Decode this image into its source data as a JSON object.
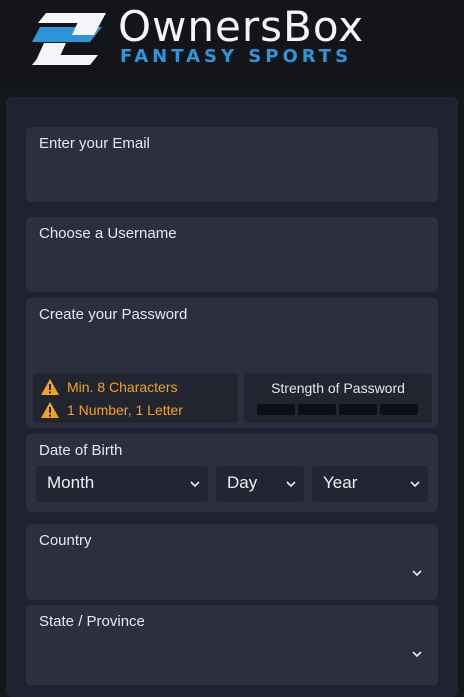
{
  "brand": {
    "name": "OwnersBox",
    "tagline": "FANTASY SPORTS"
  },
  "colors": {
    "accent": "#2f95da",
    "warning": "#f0a41f",
    "field_bg": "#2b2f40",
    "page_bg": "#15171f"
  },
  "form": {
    "email": {
      "label": "Enter your Email",
      "value": ""
    },
    "username": {
      "label": "Choose a Username",
      "value": ""
    },
    "password": {
      "label": "Create your Password",
      "value": "",
      "requirements": [
        "Min. 8 Characters",
        "1 Number, 1 Letter"
      ],
      "strength_label": "Strength of Password",
      "strength_level": 0
    },
    "dob": {
      "label": "Date of Birth",
      "month": "Month",
      "day": "Day",
      "year": "Year"
    },
    "country": {
      "label": "Country",
      "value": ""
    },
    "state": {
      "label": "State / Province",
      "value": ""
    }
  },
  "icons": {
    "logo": "ownersbox-logo-icon",
    "warning": "warning-icon",
    "chevron": "chevron-down-icon"
  }
}
